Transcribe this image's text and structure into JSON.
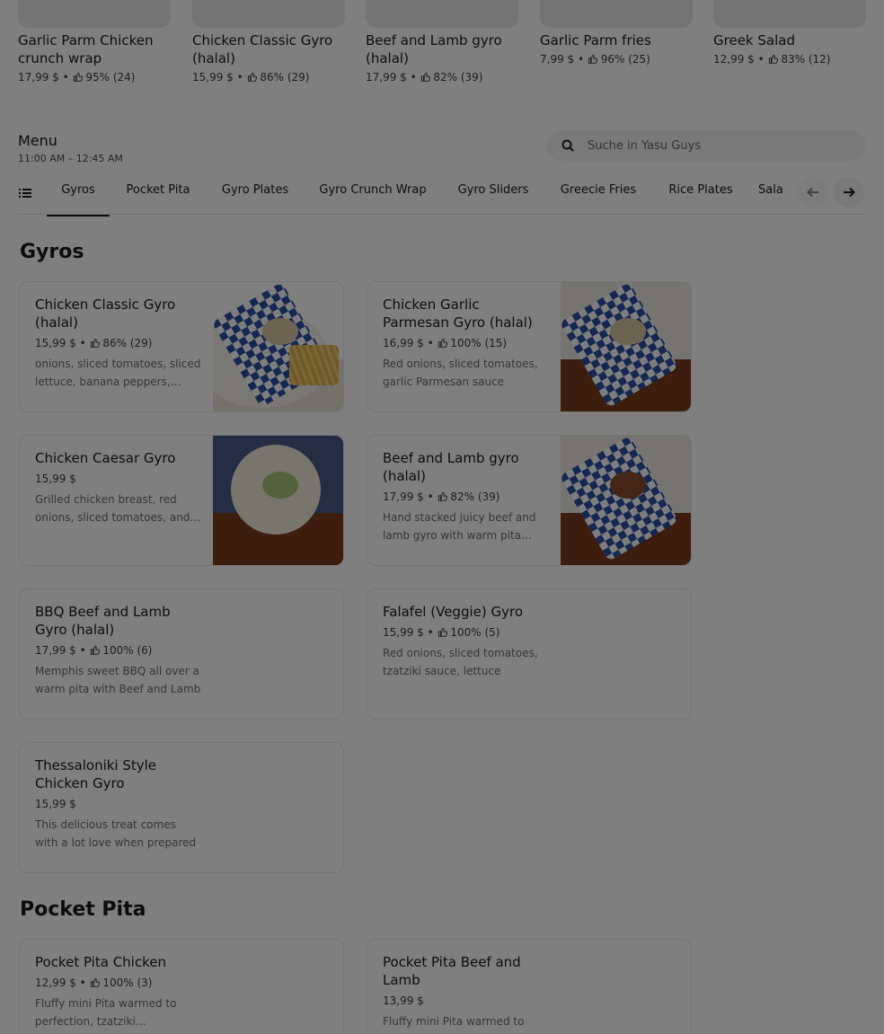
{
  "top_carousel": [
    {
      "name": "Garlic Parm Chicken crunch wrap",
      "price": "17,99 $",
      "rating": "95% (24)"
    },
    {
      "name": "Chicken Classic Gyro (halal)",
      "price": "15,99 $",
      "rating": "86% (29)"
    },
    {
      "name": "Beef and Lamb gyro (halal)",
      "price": "17,99 $",
      "rating": "82% (39)"
    },
    {
      "name": "Garlic Parm fries",
      "price": "7,99 $",
      "rating": "96% (25)"
    },
    {
      "name": "Greek Salad",
      "price": "12,99 $",
      "rating": "83% (12)"
    }
  ],
  "menu": {
    "title": "Menu",
    "hours": "11:00 AM – 12:45 AM",
    "search_placeholder": "Suche in Yasu Guys"
  },
  "tabs": [
    {
      "label": "Gyros",
      "active": true
    },
    {
      "label": "Pocket Pita"
    },
    {
      "label": "Gyro Plates"
    },
    {
      "label": "Gyro Crunch Wrap"
    },
    {
      "label": "Gyro Sliders"
    },
    {
      "label": "Greecie Fries"
    },
    {
      "label": "Rice Plates"
    },
    {
      "label": "Sala"
    }
  ],
  "sections": [
    {
      "title": "Gyros",
      "items": [
        {
          "name": "Chicken Classic Gyro (halal)",
          "price": "15,99 $",
          "rating": "86% (29)",
          "desc": "onions, sliced tomatoes, sliced lettuce, banana peppers, tzatziki sauce"
        },
        {
          "name": "Chicken Garlic Parmesan Gyro (halal)",
          "price": "16,99 $",
          "rating": "100% (15)",
          "desc": "Red onions, sliced tomatoes, garlic Parmesan sauce"
        },
        {
          "name": "Chicken Caesar Gyro",
          "price": "15,99 $",
          "rating": "",
          "desc": "Grilled chicken breast, red onions, sliced tomatoes, and caesar dressing"
        },
        {
          "name": "Beef and Lamb gyro (halal)",
          "price": "17,99 $",
          "rating": "82% (39)",
          "desc": "Hand stacked juicy beef and lamb gyro with warm pita bread"
        },
        {
          "name": "BBQ Beef and Lamb Gyro (halal)",
          "price": "17,99 $",
          "rating": "100% (6)",
          "desc": "Memphis sweet BBQ all over a warm pita with Beef and Lamb"
        },
        {
          "name": "Falafel (Veggie) Gyro",
          "price": "15,99 $",
          "rating": "100% (5)",
          "desc": "Red onions, sliced tomatoes, tzatziki sauce, lettuce"
        },
        {
          "name": "Thessaloniki Style Chicken Gyro",
          "price": "15,99 $",
          "rating": "",
          "desc": "This delicious treat comes with a lot love when prepared"
        }
      ]
    },
    {
      "title": "Pocket Pita",
      "items": [
        {
          "name": "Pocket Pita Chicken",
          "price": "12,99 $",
          "rating": "100% (3)",
          "desc": "Fluffy mini Pita warmed to perfection, tzatziki (homemade)"
        },
        {
          "name": "Pocket Pita Beef and Lamb",
          "price": "13,99 $",
          "rating": "",
          "desc": "Fluffy mini Pita warmed to perfection"
        }
      ]
    }
  ],
  "icons": {
    "search": "search-icon",
    "list": "list-icon",
    "thumb": "thumbs-up-icon",
    "prev": "arrow-left-icon",
    "next": "arrow-right-icon"
  }
}
